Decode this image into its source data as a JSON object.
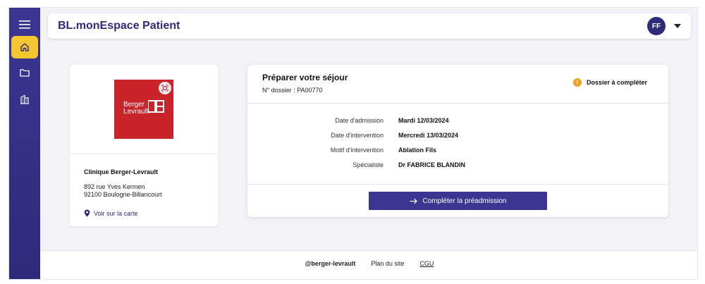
{
  "header": {
    "app_title": "BL.monEspace Patient",
    "avatar_initials": "FF"
  },
  "sidebar": {
    "items": [
      {
        "icon": "menu-icon"
      },
      {
        "icon": "home-icon",
        "active": true
      },
      {
        "icon": "folder-icon"
      },
      {
        "icon": "building-icon"
      }
    ]
  },
  "clinic": {
    "logo_line1": "Berger",
    "logo_line2": "Levrault",
    "name": "Clinique Berger-Levrault",
    "address_line1": "892 rue Yves Kermen",
    "address_line2": "92100 Boulogne-Billancourt",
    "map_link": "Voir sur la carte"
  },
  "stay": {
    "title": "Préparer votre séjour",
    "dossier": "N° dossier : PA00770",
    "status": "Dossier à compléter",
    "rows": [
      {
        "label": "Date d'admission",
        "value": "Mardi 12/03/2024"
      },
      {
        "label": "Date d'intervention",
        "value": "Mercredi 13/03/2024"
      },
      {
        "label": "Motif d'intervention",
        "value": "Ablation Fils"
      },
      {
        "label": "Spécialiste",
        "value": "Dr FABRICE BLANDIN"
      }
    ],
    "cta_label": "Compléter la préadmission"
  },
  "footer": {
    "brand": "@berger-levrault",
    "sitemap": "Plan du site",
    "cgu": "CGU"
  },
  "colors": {
    "primary": "#2f2a7a",
    "accent": "#f5c62f",
    "logo_red": "#c8242a",
    "warning": "#f0a020"
  }
}
